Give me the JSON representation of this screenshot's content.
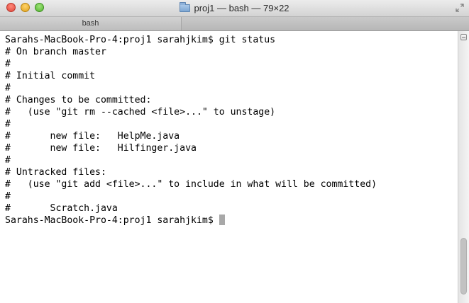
{
  "window": {
    "title": "proj1 — bash — 79×22",
    "folder_icon": "folder-icon",
    "fullscreen_icon": "fullscreen-arrows-icon"
  },
  "tabs": [
    {
      "label": "bash",
      "active": true
    }
  ],
  "terminal": {
    "lines": [
      "Sarahs-MacBook-Pro-4:proj1 sarahjkim$ git status",
      "# On branch master",
      "#",
      "# Initial commit",
      "#",
      "# Changes to be committed:",
      "#   (use \"git rm --cached <file>...\" to unstage)",
      "#",
      "#       new file:   HelpMe.java",
      "#       new file:   Hilfinger.java",
      "#",
      "# Untracked files:",
      "#   (use \"git add <file>...\" to include in what will be committed)",
      "#",
      "#       Scratch.java",
      "Sarahs-MacBook-Pro-4:proj1 sarahjkim$ "
    ],
    "cursor_color": "#a8a8a8",
    "text_color": "#000000",
    "background": "#ffffff"
  },
  "scrollbar": {
    "position_fraction": 0.97,
    "visible_fraction": 0.22
  }
}
